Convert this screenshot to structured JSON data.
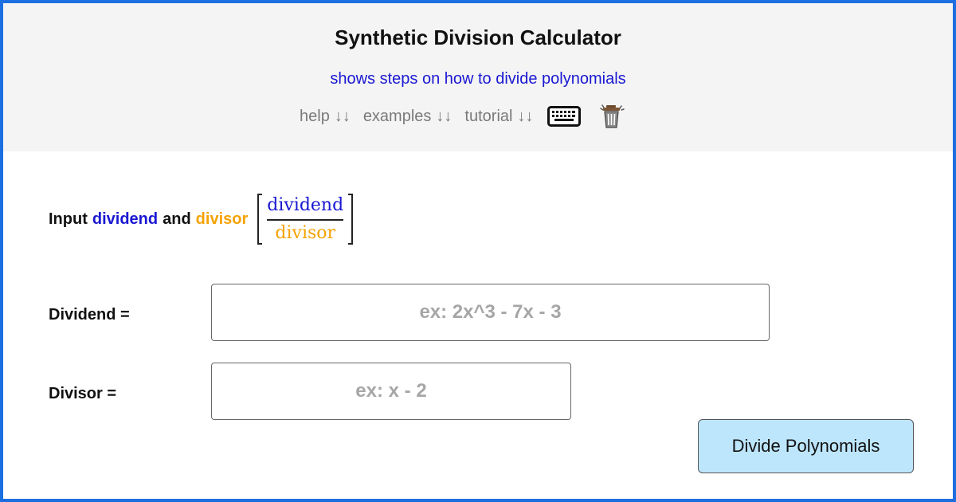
{
  "header": {
    "title": "Synthetic Division Calculator",
    "subtitle": "shows steps on how to divide polynomials",
    "nav": [
      {
        "label": "help",
        "arrows": "↓↓"
      },
      {
        "label": "examples",
        "arrows": "↓↓"
      },
      {
        "label": "tutorial",
        "arrows": "↓↓"
      }
    ],
    "icons": [
      "keyboard-icon",
      "trash-icon"
    ]
  },
  "instruction": {
    "prefix": "Input",
    "dividend_word": "dividend",
    "and_word": "and",
    "divisor_word": "divisor",
    "fraction_numerator": "dividend",
    "fraction_denominator": "divisor"
  },
  "fields": {
    "dividend_label": "Dividend =",
    "dividend_placeholder": "ex: 2x^3 - 7x - 3",
    "dividend_value": "",
    "divisor_label": "Divisor =",
    "divisor_placeholder": "ex: x - 2",
    "divisor_value": ""
  },
  "button": {
    "label": "Divide Polynomials"
  },
  "colors": {
    "border": "#1d6ee0",
    "header_bg": "#f4f4f4",
    "accent_blue": "#1a18d2",
    "accent_orange": "#f5a202",
    "button_bg": "#bde6fd"
  }
}
